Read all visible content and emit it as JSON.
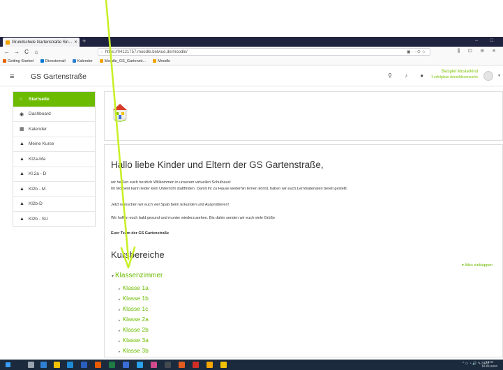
{
  "browser": {
    "tab_title": "Grundschule Gartenstraße Sin...",
    "tab_close": "✕",
    "new_tab": "+",
    "window_controls": [
      "–",
      "□"
    ],
    "nav_back": "←",
    "nav_forward": "→",
    "nav_reload": "C",
    "nav_home": "⌂",
    "shield": "◌",
    "url": "https://04121757.moodle.belwue.de/moodle/",
    "url_actions": "▣   ··· ⊙ ☆",
    "right_tools": "⫼ ▢ ⊛ ≡",
    "bookmarks": [
      {
        "label": "Getting Started",
        "color": "#e66000"
      },
      {
        "label": "Dienstemail",
        "color": "#0078d4"
      },
      {
        "label": "Kalender",
        "color": "#2a7fd4"
      },
      {
        "label": "Moodle_GS_Gartenstr...",
        "color": "#f2a100"
      },
      {
        "label": "Moodle",
        "color": "#f2a100"
      }
    ]
  },
  "moodle_header": {
    "site_name": "GS Gartenstraße",
    "menu_icon": "≡",
    "icons": "⚲ ♪ ●",
    "user_name": "Beispiel Musterkind",
    "login_note": "1 erfolglose Anmeldeversuche",
    "avatar_caret": "▾"
  },
  "sidebar": {
    "items": [
      {
        "label": "Startseite",
        "icon": "⌂",
        "active": true
      },
      {
        "label": "Dashboard",
        "icon": "◉",
        "active": false
      },
      {
        "label": "Kalender",
        "icon": "▦",
        "active": false
      },
      {
        "label": "Meine Kurse",
        "icon": "▲",
        "active": false
      },
      {
        "label": "Kl2a-Ma",
        "icon": "▲",
        "active": false
      },
      {
        "label": "Kl.2a - D",
        "icon": "▲",
        "active": false
      },
      {
        "label": "Kl2b - M",
        "icon": "▲",
        "active": false
      },
      {
        "label": "Kl2b-D",
        "icon": "▲",
        "active": false
      },
      {
        "label": "Kl2b - SU",
        "icon": "▲",
        "active": false
      }
    ]
  },
  "main": {
    "headline": "Hallo liebe Kinder und Eltern der GS Gartenstraße,",
    "paragraphs": [
      "wir heißen euch herzlich Willkommen in unserem virtuellen Schulhaus!",
      "Im Moment kann leider kein Unterricht stattfinden. Damit ihr zu Hause weiterhin lernen könnt, haben wir euch Lernmaterialen bereit gestellt.",
      "Jetzt wünschen wir euch viel Spaß beim Erkunden und Ausprobieren!",
      "Wir hoffen euch bald gesund und munter wiederzusehen. Bis dahin senden wir euch viele Grüße",
      "Euer Team der GS Gartenstraße"
    ],
    "section_title": "Kursbereiche",
    "collapse_all": "▾ Alles einklappen",
    "main_category": "Klassenzimmer",
    "expanded_caret": "▾",
    "collapsed_caret": "▸",
    "subcategories": [
      "Klasse 1a",
      "Klasse 1b",
      "Klasse 1c",
      "Klasse 2a",
      "Klasse 2b",
      "Klasse 3a",
      "Klasse 3b"
    ]
  },
  "taskbar": {
    "tray_text": "^ ▭ ◔ 🔊 ✎ DEU",
    "time": "13:31",
    "date": "16.04.2020",
    "icon_colors": [
      "#9aa4ae",
      "#2f7fd3",
      "#f2c200",
      "#1f8ad4",
      "#2b5fbf",
      "#e65a00",
      "#1e7b45",
      "#3a6fd8",
      "#2aa0e8",
      "#d04a8c",
      "#444a52",
      "#e25b1f",
      "#d12e26",
      "#f7a600",
      "#f2c200"
    ]
  },
  "colors": {
    "accent": "#6cbb00",
    "annotation_arrow": "#c8f028"
  }
}
